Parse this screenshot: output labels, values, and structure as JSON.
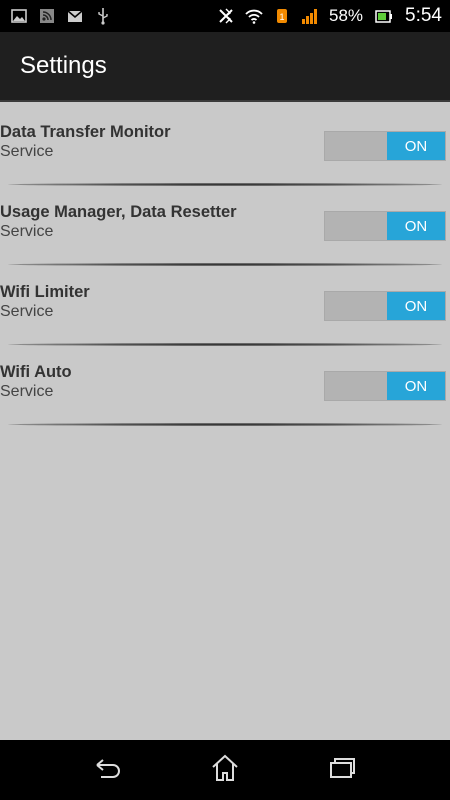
{
  "status_bar": {
    "left_icons": [
      "gallery-icon",
      "news-feed-icon",
      "gmail-icon",
      "usb-icon"
    ],
    "right_icons": [
      "nfc-icon",
      "wifi-icon",
      "notification-1-icon",
      "signal-icon",
      "battery-icon"
    ],
    "battery_percent": "58%",
    "time": "5:54"
  },
  "action_bar": {
    "title": "Settings"
  },
  "settings": [
    {
      "title": "Data Transfer Monitor",
      "subtitle": "Service",
      "toggle_label": "ON",
      "on": true
    },
    {
      "title": "Usage Manager, Data Resetter",
      "subtitle": "Service",
      "toggle_label": "ON",
      "on": true
    },
    {
      "title": "Wifi Limiter",
      "subtitle": "Service",
      "toggle_label": "ON",
      "on": true
    },
    {
      "title": "Wifi Auto",
      "subtitle": "Service",
      "toggle_label": "ON",
      "on": true
    }
  ],
  "nav_bar": {
    "buttons": [
      "back-icon",
      "home-icon",
      "recent-apps-icon"
    ]
  },
  "colors": {
    "toggle_on": "#27a5d8",
    "background": "#c9c9c9",
    "action_bar": "#1f1f1f"
  }
}
